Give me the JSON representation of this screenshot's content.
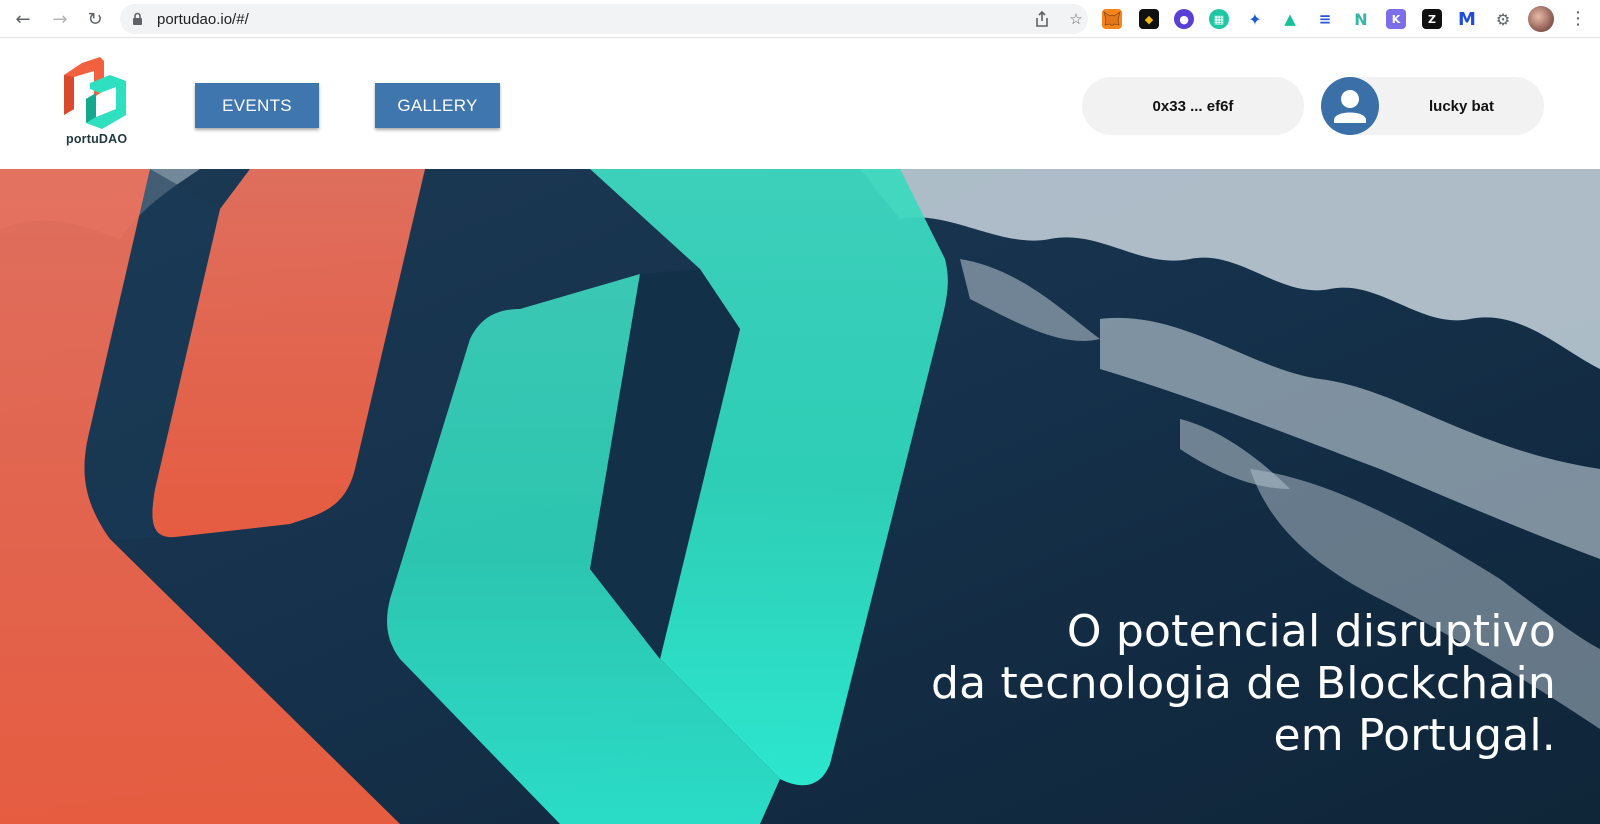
{
  "browser": {
    "url": "portudao.io/#/",
    "icons": [
      "back-icon",
      "forward-icon",
      "reload-icon",
      "lock-icon",
      "share-icon",
      "bookmark-star-icon",
      "extensions-icon",
      "menu-icon"
    ]
  },
  "site": {
    "logo_text": "portuDAO",
    "nav": {
      "events_label": "EVENTS",
      "gallery_label": "GALLERY"
    },
    "wallet": {
      "address": "0x33 ... ef6f"
    },
    "user": {
      "name": "lucky bat"
    }
  },
  "hero": {
    "line1": "O potencial disruptivo",
    "line2": "da tecnologia de Blockchain",
    "line3": "em Portugal."
  },
  "colors": {
    "nav_button": "#3f76ae",
    "brand_orange": "#f2603f",
    "brand_teal": "#2ee8c9",
    "ocean": "#17324a"
  }
}
